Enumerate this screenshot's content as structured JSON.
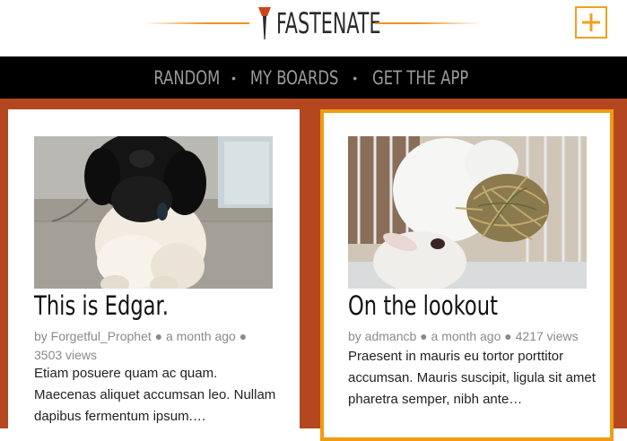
{
  "header": {
    "logo_text": "FASTENATE",
    "add_button_symbol": "+"
  },
  "nav": {
    "items": [
      "RANDOM",
      "MY BOARDS",
      "GET THE APP"
    ],
    "separator": "•"
  },
  "colors": {
    "accent": "#f29a14",
    "background_band": "#b4471f",
    "nav_background": "#000000"
  },
  "cards": [
    {
      "title": "This is Edgar.",
      "author": "by Forgetful_Prophet",
      "time": "a month ago",
      "views": "3503 views",
      "description": "Etiam posuere quam ac quam. Maecenas aliquet accumsan leo. Nullam dapibus fermentum ipsum.…",
      "image_subject": "black and white puppy"
    },
    {
      "title": "On the lookout",
      "author": "by admancb",
      "time": "a month ago",
      "views": "4217 views",
      "description": "Praesent in mauris eu tortor porttitor accumsan. Mauris suscipit, ligula sit amet pharetra semper, nibh ante…",
      "image_subject": "white rabbit with hay ball"
    }
  ]
}
